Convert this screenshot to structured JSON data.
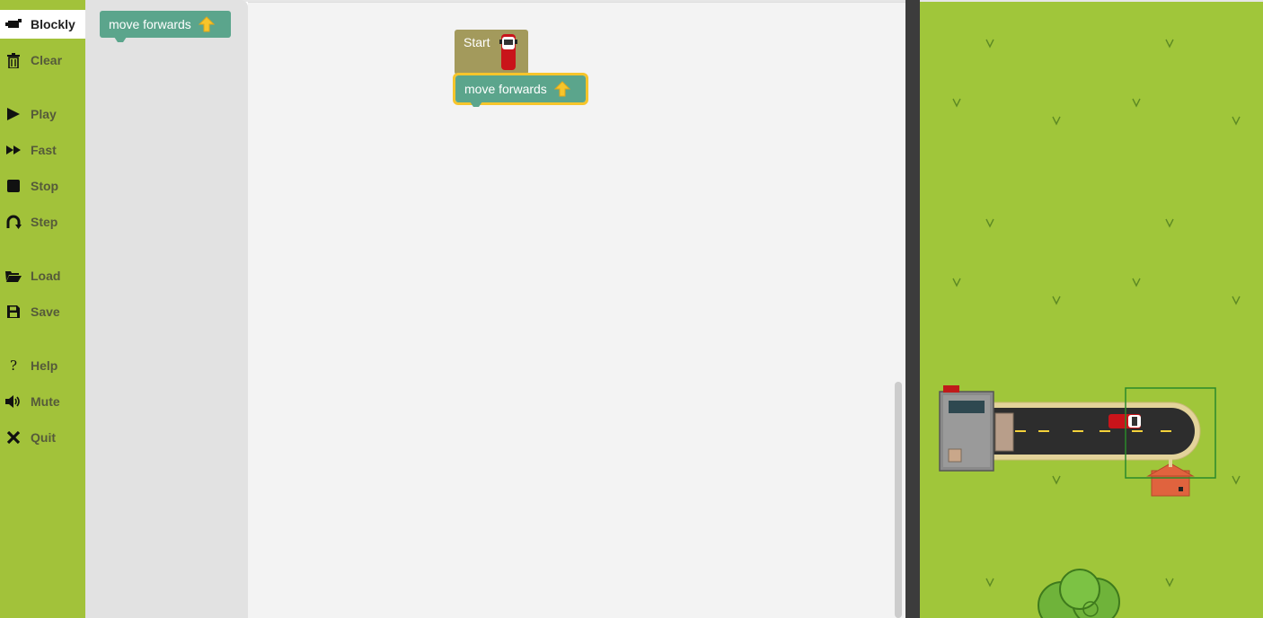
{
  "menu": {
    "items": [
      {
        "label": "Blockly",
        "icon": "puzzle-icon",
        "active": true
      },
      {
        "label": "Clear",
        "icon": "trash-icon"
      },
      {
        "label": "Play",
        "icon": "play-icon"
      },
      {
        "label": "Fast",
        "icon": "fast-forward-icon"
      },
      {
        "label": "Stop",
        "icon": "stop-icon"
      },
      {
        "label": "Step",
        "icon": "step-icon"
      },
      {
        "label": "Load",
        "icon": "folder-open-icon"
      },
      {
        "label": "Save",
        "icon": "floppy-disk-icon"
      },
      {
        "label": "Help",
        "icon": "question-icon"
      },
      {
        "label": "Mute",
        "icon": "speaker-icon"
      },
      {
        "label": "Quit",
        "icon": "close-icon"
      }
    ]
  },
  "flyout": {
    "move_block_label": "move forwards"
  },
  "workspace": {
    "start_block_label": "Start",
    "move_block_label": "move forwards"
  },
  "colors": {
    "menu_bg": "#a2c23a",
    "grass": "#a0c63a",
    "move_block": "#5ba58c",
    "start_block": "#a39a5c",
    "selection": "#f7c52b"
  }
}
